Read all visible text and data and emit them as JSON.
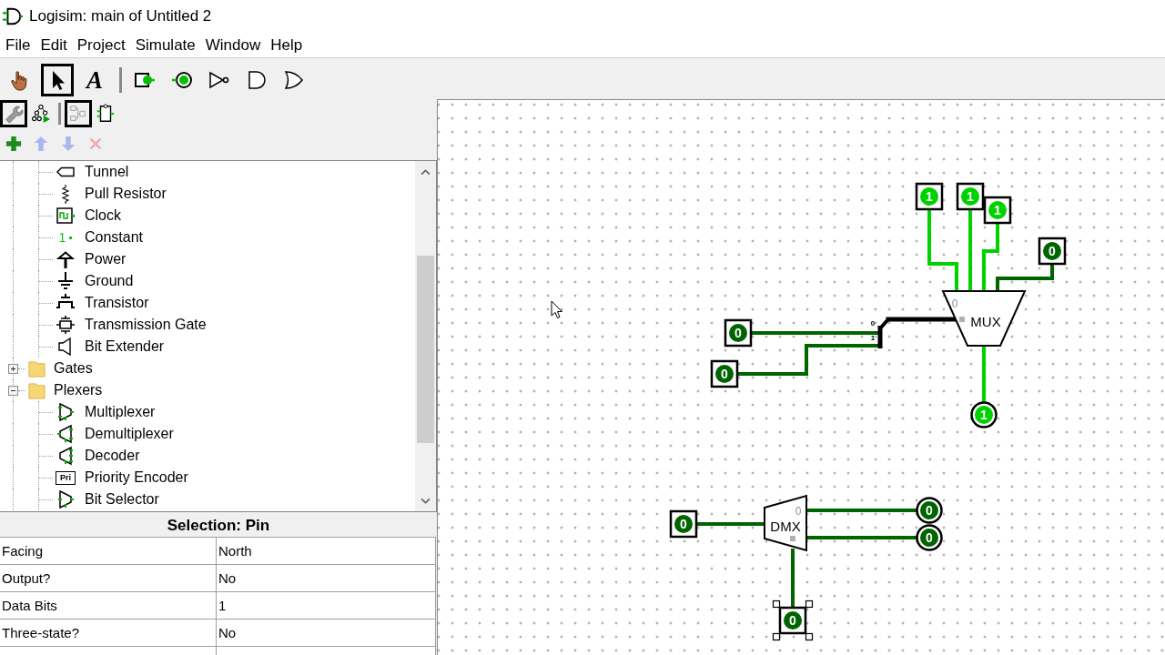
{
  "window": {
    "title": "Logisim: main of Untitled 2"
  },
  "menu": [
    "File",
    "Edit",
    "Project",
    "Simulate",
    "Window",
    "Help"
  ],
  "toolbar": {
    "tool_groups": [
      [
        {
          "kind": "hand",
          "selected": false
        },
        {
          "kind": "arrow",
          "selected": true
        },
        {
          "kind": "text",
          "label": "A",
          "selected": false
        }
      ],
      [
        {
          "kind": "input-pin",
          "selected": false
        },
        {
          "kind": "output-pin",
          "selected": false
        },
        {
          "kind": "not-gate",
          "selected": false
        },
        {
          "kind": "and-gate",
          "selected": false
        },
        {
          "kind": "or-gate",
          "selected": false
        }
      ]
    ],
    "view_groups": [
      [
        {
          "kind": "wrench",
          "selected": true
        },
        {
          "kind": "simulation-tree",
          "selected": false
        }
      ],
      [
        {
          "kind": "layout",
          "selected": true
        },
        {
          "kind": "appearance",
          "selected": false
        }
      ]
    ],
    "edit_buttons": [
      {
        "kind": "add",
        "disabled": false
      },
      {
        "kind": "up",
        "disabled": true
      },
      {
        "kind": "down",
        "disabled": true
      },
      {
        "kind": "delete",
        "disabled": true
      }
    ]
  },
  "tree": {
    "items": [
      {
        "children": [
          {
            "label": "Tunnel",
            "kind": "tunnel",
            "selected": false
          },
          {
            "label": "Pull Resistor",
            "kind": "pull-resistor",
            "selected": false
          },
          {
            "label": "Clock",
            "kind": "clock",
            "selected": false
          },
          {
            "label": "Constant",
            "kind": "constant",
            "icon_text": "1",
            "selected": false
          },
          {
            "label": "Power",
            "kind": "power",
            "selected": false
          },
          {
            "label": "Ground",
            "kind": "ground",
            "selected": false
          },
          {
            "label": "Transistor",
            "kind": "transistor",
            "selected": false
          },
          {
            "label": "Transmission Gate",
            "kind": "transmission-gate",
            "selected": false
          },
          {
            "label": "Bit Extender",
            "kind": "bit-extender",
            "selected": false
          }
        ]
      },
      {
        "label": "Gates",
        "kind": "folder",
        "expanded": false,
        "selected": false
      },
      {
        "label": "Plexers",
        "kind": "folder",
        "expanded": true,
        "selected": false,
        "children": [
          {
            "label": "Multiplexer",
            "kind": "multiplexer",
            "selected": false
          },
          {
            "label": "Demultiplexer",
            "kind": "demultiplexer",
            "selected": false
          },
          {
            "label": "Decoder",
            "kind": "decoder",
            "selected": false
          },
          {
            "label": "Priority Encoder",
            "kind": "priority-encoder",
            "icon_text": "Pri",
            "selected": false
          },
          {
            "label": "Bit Selector",
            "kind": "bit-selector",
            "selected": false
          }
        ]
      }
    ]
  },
  "properties": {
    "title": "Selection: Pin",
    "rows": [
      {
        "name": "Facing",
        "value": "North"
      },
      {
        "name": "Output?",
        "value": "No"
      },
      {
        "name": "Data Bits",
        "value": "1"
      },
      {
        "name": "Three-state?",
        "value": "No"
      }
    ]
  },
  "canvas": {
    "components": [
      {
        "kind": "input-pin",
        "value": "1",
        "high": true,
        "selected": false
      },
      {
        "kind": "input-pin",
        "value": "1",
        "high": true,
        "selected": false
      },
      {
        "kind": "input-pin",
        "value": "1",
        "high": true,
        "selected": false
      },
      {
        "kind": "input-pin",
        "value": "0",
        "high": false,
        "selected": false
      },
      {
        "kind": "multiplexer",
        "label": "MUX",
        "port_label": "0",
        "selected": false
      },
      {
        "kind": "input-pin",
        "value": "0",
        "high": false,
        "selected": false
      },
      {
        "kind": "input-pin",
        "value": "0",
        "high": false,
        "selected": false
      },
      {
        "kind": "splitter",
        "port_labels": [
          "0",
          "1"
        ],
        "selected": false
      },
      {
        "kind": "output-pin",
        "value": "1",
        "high": true,
        "selected": false
      },
      {
        "kind": "input-pin",
        "value": "0",
        "high": false,
        "selected": false
      },
      {
        "kind": "demultiplexer",
        "label": "DMX",
        "port_label": "0",
        "selected": false
      },
      {
        "kind": "output-pin",
        "value": "0",
        "high": false,
        "selected": false
      },
      {
        "kind": "output-pin",
        "value": "0",
        "high": false,
        "selected": false
      },
      {
        "kind": "input-pin",
        "value": "0",
        "high": false,
        "selected": true
      }
    ],
    "wires": [
      {
        "kind": "bit",
        "high": true
      },
      {
        "kind": "bit",
        "high": true
      },
      {
        "kind": "bit",
        "high": true
      },
      {
        "kind": "bit",
        "high": false
      },
      {
        "kind": "bit",
        "high": false
      },
      {
        "kind": "bit",
        "high": false
      },
      {
        "kind": "bus"
      },
      {
        "kind": "bit",
        "high": true
      },
      {
        "kind": "bit",
        "high": false
      },
      {
        "kind": "bit",
        "high": false
      },
      {
        "kind": "bit",
        "high": false
      },
      {
        "kind": "bit",
        "high": false
      }
    ]
  }
}
